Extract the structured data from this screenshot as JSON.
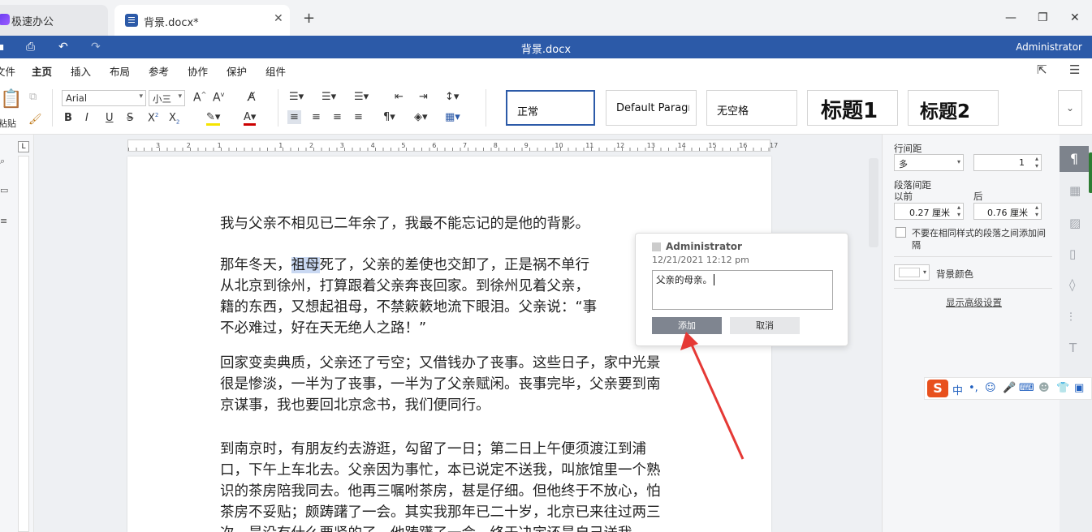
{
  "tabs": {
    "app_tab_label": "极速办公",
    "doc_tab_label": "背景.docx*",
    "close_glyph": "✕",
    "new_tab_glyph": "+"
  },
  "window": {
    "min": "—",
    "max": "❐",
    "close": "✕"
  },
  "titlebar": {
    "title": "背景.docx",
    "user": "Administrator"
  },
  "menu": {
    "items": [
      "文件",
      "主页",
      "插入",
      "布局",
      "参考",
      "协作",
      "保护",
      "组件"
    ],
    "active": "主页"
  },
  "ribbon": {
    "paste_label": "粘贴",
    "font_name": "Arial",
    "font_size": "小三",
    "styles": [
      "正常",
      "Default Paragr",
      "无空格",
      "标题1",
      "标题2"
    ],
    "more_glyph": "⌄"
  },
  "ruler": {
    "numbers": [
      "3",
      "2",
      "1",
      "",
      "1",
      "2",
      "3",
      "4",
      "5",
      "6",
      "7",
      "8",
      "9",
      "10",
      "11",
      "12",
      "13",
      "14",
      "15",
      "16",
      "17"
    ]
  },
  "document": {
    "p1": "我与父亲不相见已二年余了，我最不能忘记的是他的背影。",
    "p2_lines": [
      "那年冬天，",
      "祖母",
      "死了，父亲的差使也交卸了，正是祸不单行",
      "从北京到徐州，打算跟着父亲奔丧回家。到徐州见着父亲，",
      "籍的东西，又想起祖母，不禁簌簌地流下眼泪。父亲说：“事",
      "不必难过，好在天无绝人之路！”"
    ],
    "p3_lines": [
      "回家变卖典质，父亲还了亏空；又借钱办了丧事。这些日子，家中光景",
      "很是惨淡，一半为了丧事，一半为了父亲赋闲。丧事完毕，父亲要到南",
      "京谋事，我也要回北京念书，我们便同行。"
    ],
    "p4_lines": [
      "到南京时，有朋友约去游逛，勾留了一日；第二日上午便须渡江到浦",
      "口，下午上车北去。父亲因为事忙，本已说定不送我，叫旅馆里一个熟",
      "识的茶房陪我同去。他再三嘱咐茶房，甚是仔细。但他终于不放心，怕",
      "茶房不妥贴；颇踌躇了一会。其实我那年已二十岁，北京已来往过两三",
      "次，是没有什么要紧的了。他踌躇了一会，终于决定还是自己送我。"
    ]
  },
  "comment": {
    "author": "Administrator",
    "date": "12/21/2021 12:12 pm",
    "text": "父亲的母亲。",
    "add_label": "添加",
    "cancel_label": "取消"
  },
  "panel": {
    "line_spacing_label": "行间距",
    "line_spacing_type": "多",
    "line_spacing_value": "1",
    "para_spacing_label": "段落间距",
    "before_label": "以前",
    "after_label": "后",
    "before_value": "0.27 厘米",
    "after_value": "0.76 厘米",
    "no_space_checkbox_line1": "不要在相同样式的段落之间添加间",
    "no_space_checkbox_line2": "隔",
    "bg_color_label": "背景颜色",
    "advanced_link": "显示高级设置"
  },
  "ime": {
    "logo": "S",
    "lang": "中"
  },
  "colors": {
    "brand": "#2c5aa8",
    "highlight": "#c9d8f2",
    "arrow": "#e53935",
    "ime_logo": "#e8501d"
  }
}
